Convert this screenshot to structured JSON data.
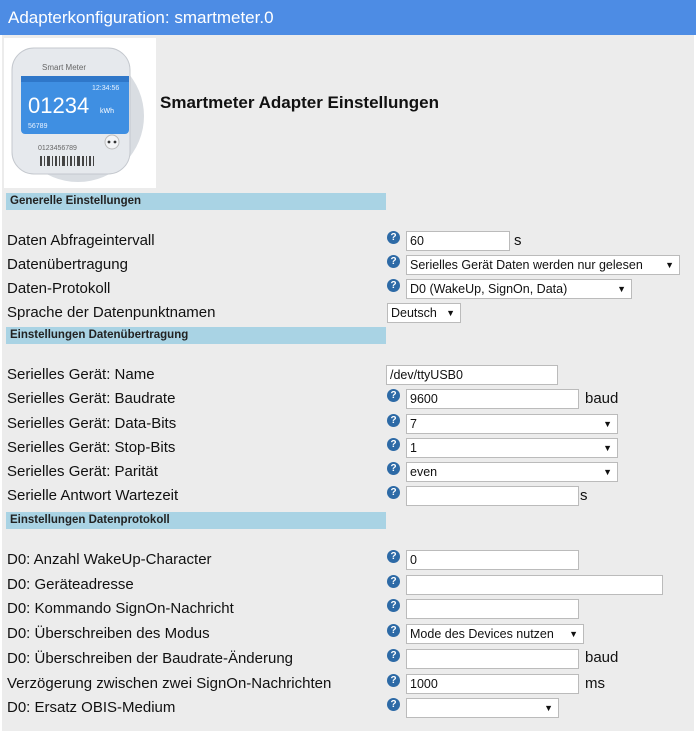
{
  "window": {
    "title": "Adapterkonfiguration: smartmeter.0"
  },
  "header": {
    "heading": "Smartmeter Adapter Einstellungen",
    "logo": {
      "brand": "Smart Meter",
      "time": "12:34:56",
      "reading": "01234",
      "unit": "kWh",
      "small_number": "56789",
      "serial": "0123456789"
    }
  },
  "sections": {
    "general": "Generelle Einstellungen",
    "transfer": "Einstellungen Datenübertragung",
    "protocol": "Einstellungen Datenprotokoll"
  },
  "general": {
    "interval": {
      "label": "Daten Abfrageintervall",
      "value": "60",
      "unit": "s"
    },
    "transfer": {
      "label": "Datenübertragung",
      "selected": "Serielles Gerät Daten werden nur gelesen"
    },
    "protocol": {
      "label": "Daten-Protokoll",
      "selected": "D0 (WakeUp, SignOn, Data)"
    },
    "language": {
      "label": "Sprache der Datenpunktnamen",
      "selected": "Deutsch"
    }
  },
  "serial": {
    "name": {
      "label": "Serielles Gerät: Name",
      "value": "/dev/ttyUSB0"
    },
    "baudrate": {
      "label": "Serielles Gerät: Baudrate",
      "value": "9600",
      "unit": "baud"
    },
    "databits": {
      "label": "Serielles Gerät: Data-Bits",
      "selected": "7"
    },
    "stopbits": {
      "label": "Serielles Gerät: Stop-Bits",
      "selected": "1"
    },
    "parity": {
      "label": "Serielles Gerät: Parität",
      "selected": "even"
    },
    "timeout": {
      "label": "Serielle Antwort Wartezeit",
      "value": "",
      "unit": "s"
    }
  },
  "d0": {
    "wakeup": {
      "label": "D0: Anzahl WakeUp-Character",
      "value": "0"
    },
    "address": {
      "label": "D0: Geräteadresse",
      "value": ""
    },
    "signon": {
      "label": "D0: Kommando SignOn-Nachricht",
      "value": ""
    },
    "mode": {
      "label": "D0: Überschreiben des Modus",
      "selected": "Mode des Devices nutzen"
    },
    "baudchange": {
      "label": "D0: Überschreiben der Baudrate-Änderung",
      "value": "",
      "unit": "baud"
    },
    "delay": {
      "label": "Verzögerung zwischen zwei SignOn-Nachrichten",
      "value": "1000",
      "unit": "ms"
    },
    "medium": {
      "label": "D0: Ersatz OBIS-Medium",
      "selected": ""
    }
  },
  "icons": {
    "help": "help-icon",
    "dropdown": "chevron-down-icon"
  },
  "colors": {
    "titlebar": "#4d8ce4",
    "section": "#a9d3e4",
    "help_icon": "#2d6aa6",
    "background": "#ececec"
  }
}
